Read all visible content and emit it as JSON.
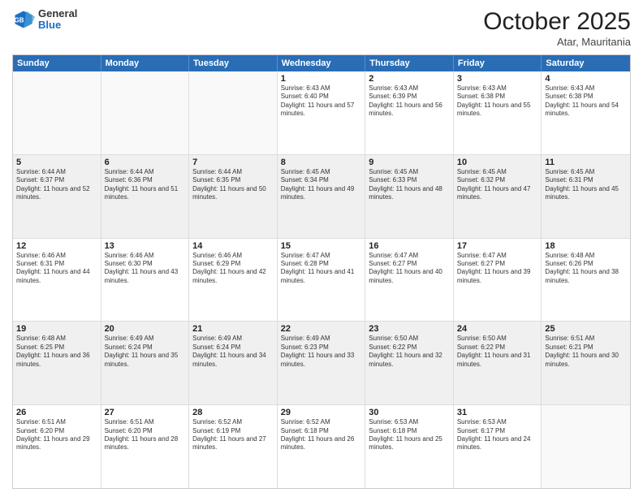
{
  "header": {
    "logo": {
      "general": "General",
      "blue": "Blue"
    },
    "title": "October 2025",
    "location": "Atar, Mauritania"
  },
  "calendar": {
    "days": [
      "Sunday",
      "Monday",
      "Tuesday",
      "Wednesday",
      "Thursday",
      "Friday",
      "Saturday"
    ],
    "rows": [
      [
        {
          "day": "",
          "empty": true
        },
        {
          "day": "",
          "empty": true
        },
        {
          "day": "",
          "empty": true
        },
        {
          "day": "1",
          "sunrise": "Sunrise: 6:43 AM",
          "sunset": "Sunset: 6:40 PM",
          "daylight": "Daylight: 11 hours and 57 minutes."
        },
        {
          "day": "2",
          "sunrise": "Sunrise: 6:43 AM",
          "sunset": "Sunset: 6:39 PM",
          "daylight": "Daylight: 11 hours and 56 minutes."
        },
        {
          "day": "3",
          "sunrise": "Sunrise: 6:43 AM",
          "sunset": "Sunset: 6:38 PM",
          "daylight": "Daylight: 11 hours and 55 minutes."
        },
        {
          "day": "4",
          "sunrise": "Sunrise: 6:43 AM",
          "sunset": "Sunset: 6:38 PM",
          "daylight": "Daylight: 11 hours and 54 minutes."
        }
      ],
      [
        {
          "day": "5",
          "sunrise": "Sunrise: 6:44 AM",
          "sunset": "Sunset: 6:37 PM",
          "daylight": "Daylight: 11 hours and 52 minutes."
        },
        {
          "day": "6",
          "sunrise": "Sunrise: 6:44 AM",
          "sunset": "Sunset: 6:36 PM",
          "daylight": "Daylight: 11 hours and 51 minutes."
        },
        {
          "day": "7",
          "sunrise": "Sunrise: 6:44 AM",
          "sunset": "Sunset: 6:35 PM",
          "daylight": "Daylight: 11 hours and 50 minutes."
        },
        {
          "day": "8",
          "sunrise": "Sunrise: 6:45 AM",
          "sunset": "Sunset: 6:34 PM",
          "daylight": "Daylight: 11 hours and 49 minutes."
        },
        {
          "day": "9",
          "sunrise": "Sunrise: 6:45 AM",
          "sunset": "Sunset: 6:33 PM",
          "daylight": "Daylight: 11 hours and 48 minutes."
        },
        {
          "day": "10",
          "sunrise": "Sunrise: 6:45 AM",
          "sunset": "Sunset: 6:32 PM",
          "daylight": "Daylight: 11 hours and 47 minutes."
        },
        {
          "day": "11",
          "sunrise": "Sunrise: 6:45 AM",
          "sunset": "Sunset: 6:31 PM",
          "daylight": "Daylight: 11 hours and 45 minutes."
        }
      ],
      [
        {
          "day": "12",
          "sunrise": "Sunrise: 6:46 AM",
          "sunset": "Sunset: 6:31 PM",
          "daylight": "Daylight: 11 hours and 44 minutes."
        },
        {
          "day": "13",
          "sunrise": "Sunrise: 6:46 AM",
          "sunset": "Sunset: 6:30 PM",
          "daylight": "Daylight: 11 hours and 43 minutes."
        },
        {
          "day": "14",
          "sunrise": "Sunrise: 6:46 AM",
          "sunset": "Sunset: 6:29 PM",
          "daylight": "Daylight: 11 hours and 42 minutes."
        },
        {
          "day": "15",
          "sunrise": "Sunrise: 6:47 AM",
          "sunset": "Sunset: 6:28 PM",
          "daylight": "Daylight: 11 hours and 41 minutes."
        },
        {
          "day": "16",
          "sunrise": "Sunrise: 6:47 AM",
          "sunset": "Sunset: 6:27 PM",
          "daylight": "Daylight: 11 hours and 40 minutes."
        },
        {
          "day": "17",
          "sunrise": "Sunrise: 6:47 AM",
          "sunset": "Sunset: 6:27 PM",
          "daylight": "Daylight: 11 hours and 39 minutes."
        },
        {
          "day": "18",
          "sunrise": "Sunrise: 6:48 AM",
          "sunset": "Sunset: 6:26 PM",
          "daylight": "Daylight: 11 hours and 38 minutes."
        }
      ],
      [
        {
          "day": "19",
          "sunrise": "Sunrise: 6:48 AM",
          "sunset": "Sunset: 6:25 PM",
          "daylight": "Daylight: 11 hours and 36 minutes."
        },
        {
          "day": "20",
          "sunrise": "Sunrise: 6:49 AM",
          "sunset": "Sunset: 6:24 PM",
          "daylight": "Daylight: 11 hours and 35 minutes."
        },
        {
          "day": "21",
          "sunrise": "Sunrise: 6:49 AM",
          "sunset": "Sunset: 6:24 PM",
          "daylight": "Daylight: 11 hours and 34 minutes."
        },
        {
          "day": "22",
          "sunrise": "Sunrise: 6:49 AM",
          "sunset": "Sunset: 6:23 PM",
          "daylight": "Daylight: 11 hours and 33 minutes."
        },
        {
          "day": "23",
          "sunrise": "Sunrise: 6:50 AM",
          "sunset": "Sunset: 6:22 PM",
          "daylight": "Daylight: 11 hours and 32 minutes."
        },
        {
          "day": "24",
          "sunrise": "Sunrise: 6:50 AM",
          "sunset": "Sunset: 6:22 PM",
          "daylight": "Daylight: 11 hours and 31 minutes."
        },
        {
          "day": "25",
          "sunrise": "Sunrise: 6:51 AM",
          "sunset": "Sunset: 6:21 PM",
          "daylight": "Daylight: 11 hours and 30 minutes."
        }
      ],
      [
        {
          "day": "26",
          "sunrise": "Sunrise: 6:51 AM",
          "sunset": "Sunset: 6:20 PM",
          "daylight": "Daylight: 11 hours and 29 minutes."
        },
        {
          "day": "27",
          "sunrise": "Sunrise: 6:51 AM",
          "sunset": "Sunset: 6:20 PM",
          "daylight": "Daylight: 11 hours and 28 minutes."
        },
        {
          "day": "28",
          "sunrise": "Sunrise: 6:52 AM",
          "sunset": "Sunset: 6:19 PM",
          "daylight": "Daylight: 11 hours and 27 minutes."
        },
        {
          "day": "29",
          "sunrise": "Sunrise: 6:52 AM",
          "sunset": "Sunset: 6:18 PM",
          "daylight": "Daylight: 11 hours and 26 minutes."
        },
        {
          "day": "30",
          "sunrise": "Sunrise: 6:53 AM",
          "sunset": "Sunset: 6:18 PM",
          "daylight": "Daylight: 11 hours and 25 minutes."
        },
        {
          "day": "31",
          "sunrise": "Sunrise: 6:53 AM",
          "sunset": "Sunset: 6:17 PM",
          "daylight": "Daylight: 11 hours and 24 minutes."
        },
        {
          "day": "",
          "empty": true
        }
      ]
    ]
  }
}
